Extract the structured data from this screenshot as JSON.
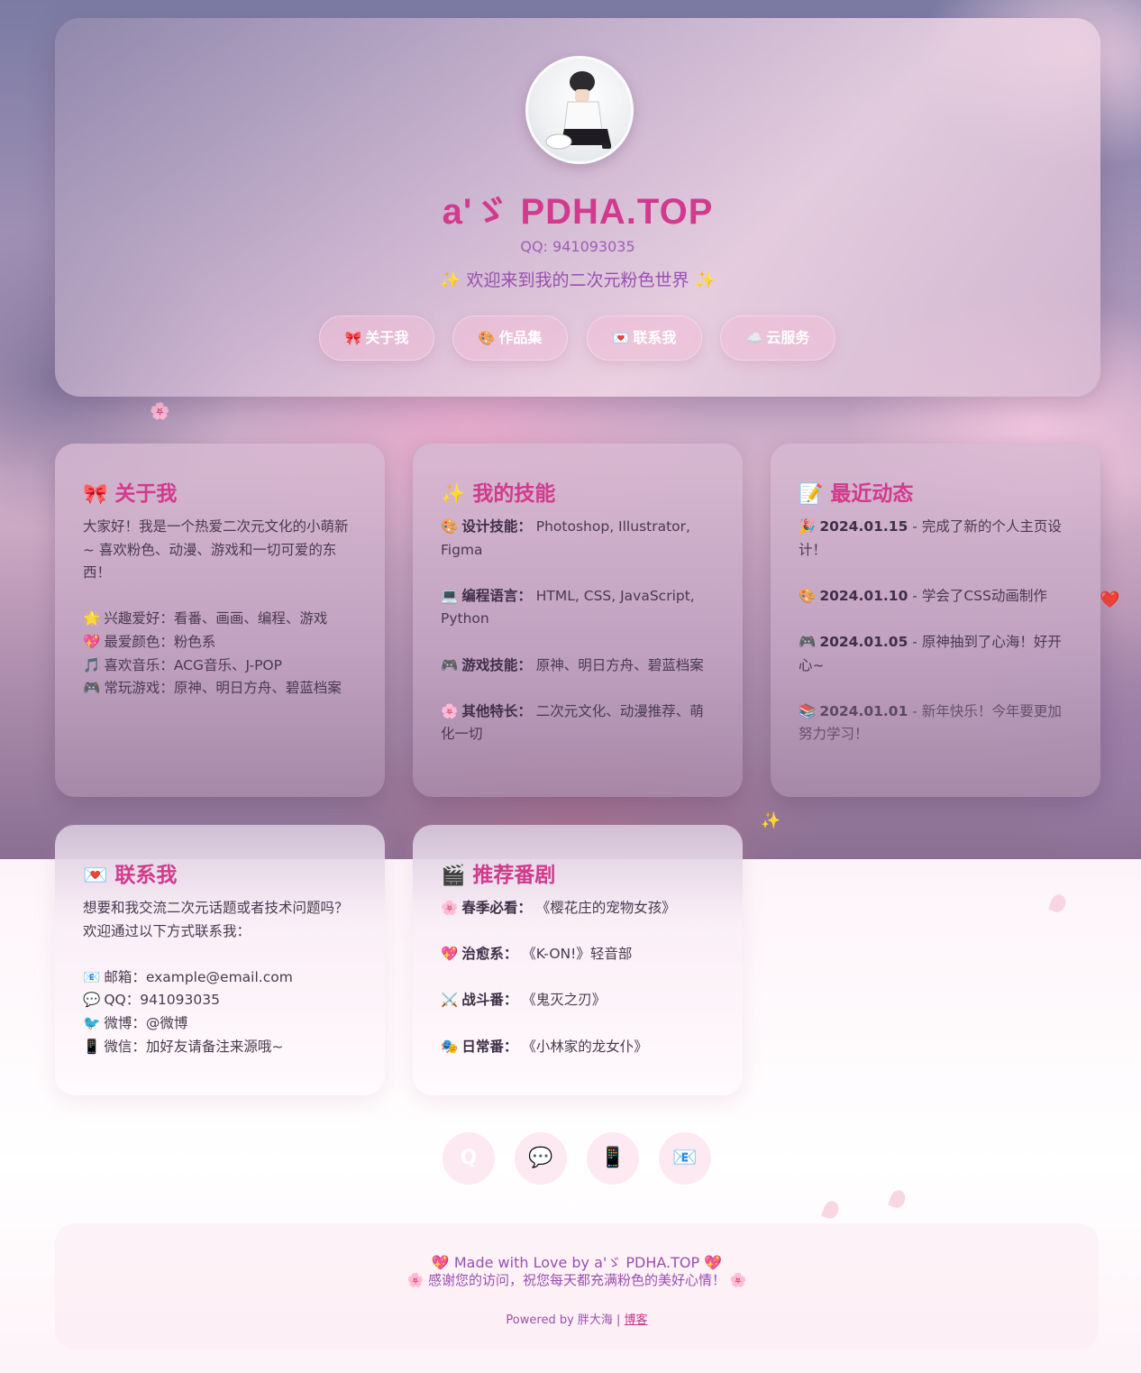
{
  "site": {
    "title": "a'ゞ PDHA.TOP",
    "qq_line": "QQ: 941093035",
    "welcome": "✨ 欢迎来到我的二次元粉色世界 ✨"
  },
  "nav": [
    {
      "icon": "🎀",
      "label": "关于我"
    },
    {
      "icon": "🎨",
      "label": "作品集"
    },
    {
      "icon": "💌",
      "label": "联系我"
    },
    {
      "icon": "☁️",
      "label": "云服务"
    }
  ],
  "about": {
    "icon": "🎀",
    "title": "关于我",
    "intro": "大家好！我是一个热爱二次元文化的小萌新~ 喜欢粉色、动漫、游戏和一切可爱的东西！",
    "items": [
      {
        "icon": "🌟",
        "text": "兴趣爱好：看番、画画、编程、游戏"
      },
      {
        "icon": "💖",
        "text": "最爱颜色：粉色系"
      },
      {
        "icon": "🎵",
        "text": "喜欢音乐：ACG音乐、J-POP"
      },
      {
        "icon": "🎮",
        "text": "常玩游戏：原神、明日方舟、碧蓝档案"
      }
    ]
  },
  "skills": {
    "icon": "✨",
    "title": "我的技能",
    "items": [
      {
        "icon": "🎨",
        "label": "设计技能：",
        "value": "Photoshop, Illustrator, Figma"
      },
      {
        "icon": "💻",
        "label": "编程语言：",
        "value": "HTML, CSS, JavaScript, Python"
      },
      {
        "icon": "🎮",
        "label": "游戏技能：",
        "value": "原神、明日方舟、碧蓝档案"
      },
      {
        "icon": "🌸",
        "label": "其他特长：",
        "value": "二次元文化、动漫推荐、萌化一切"
      }
    ]
  },
  "news": {
    "icon": "📝",
    "title": "最近动态",
    "items": [
      {
        "icon": "🎉",
        "date": "2024.01.15",
        "text": " - 完成了新的个人主页设计！"
      },
      {
        "icon": "🎨",
        "date": "2024.01.10",
        "text": " - 学会了CSS动画制作"
      },
      {
        "icon": "🎮",
        "date": "2024.01.05",
        "text": " - 原神抽到了心海！好开心~"
      },
      {
        "icon": "📚",
        "date": "2024.01.01",
        "text": " - 新年快乐！今年要更加努力学习！"
      }
    ]
  },
  "contact": {
    "icon": "💌",
    "title": "联系我",
    "intro": "想要和我交流二次元话题或者技术问题吗？欢迎通过以下方式联系我：",
    "items": [
      {
        "icon": "📧",
        "text": "邮箱：example@email.com"
      },
      {
        "icon": "💬",
        "text": "QQ：941093035"
      },
      {
        "icon": "🐦",
        "text": "微博：@微博"
      },
      {
        "icon": "📱",
        "text": "微信：加好友请备注来源哦~"
      }
    ]
  },
  "anime": {
    "icon": "🎬",
    "title": "推荐番剧",
    "items": [
      {
        "icon": "🌸",
        "label": "春季必看：",
        "value": "《樱花庄的宠物女孩》"
      },
      {
        "icon": "💖",
        "label": "治愈系：",
        "value": "《K-ON!》轻音部"
      },
      {
        "icon": "⚔️",
        "label": "战斗番：",
        "value": "《鬼灭之刃》"
      },
      {
        "icon": "🎭",
        "label": "日常番：",
        "value": "《小林家的龙女仆》"
      }
    ]
  },
  "social": [
    {
      "icon": "Q",
      "name": "qq"
    },
    {
      "icon": "💬",
      "name": "chat"
    },
    {
      "icon": "📱",
      "name": "phone"
    },
    {
      "icon": "📧",
      "name": "email"
    }
  ],
  "footer": {
    "line1": "💖 Made with Love by a'ゞ PDHA.TOP 💖",
    "line2": "🌸 感谢您的访问，祝您每天都充满粉色的美好心情！ 🌸",
    "powered_prefix": "Powered by 胖大海 | ",
    "blog_link": "博客"
  },
  "colors": {
    "accent": "#d23a8d",
    "purple_text": "#9b4fb0"
  }
}
